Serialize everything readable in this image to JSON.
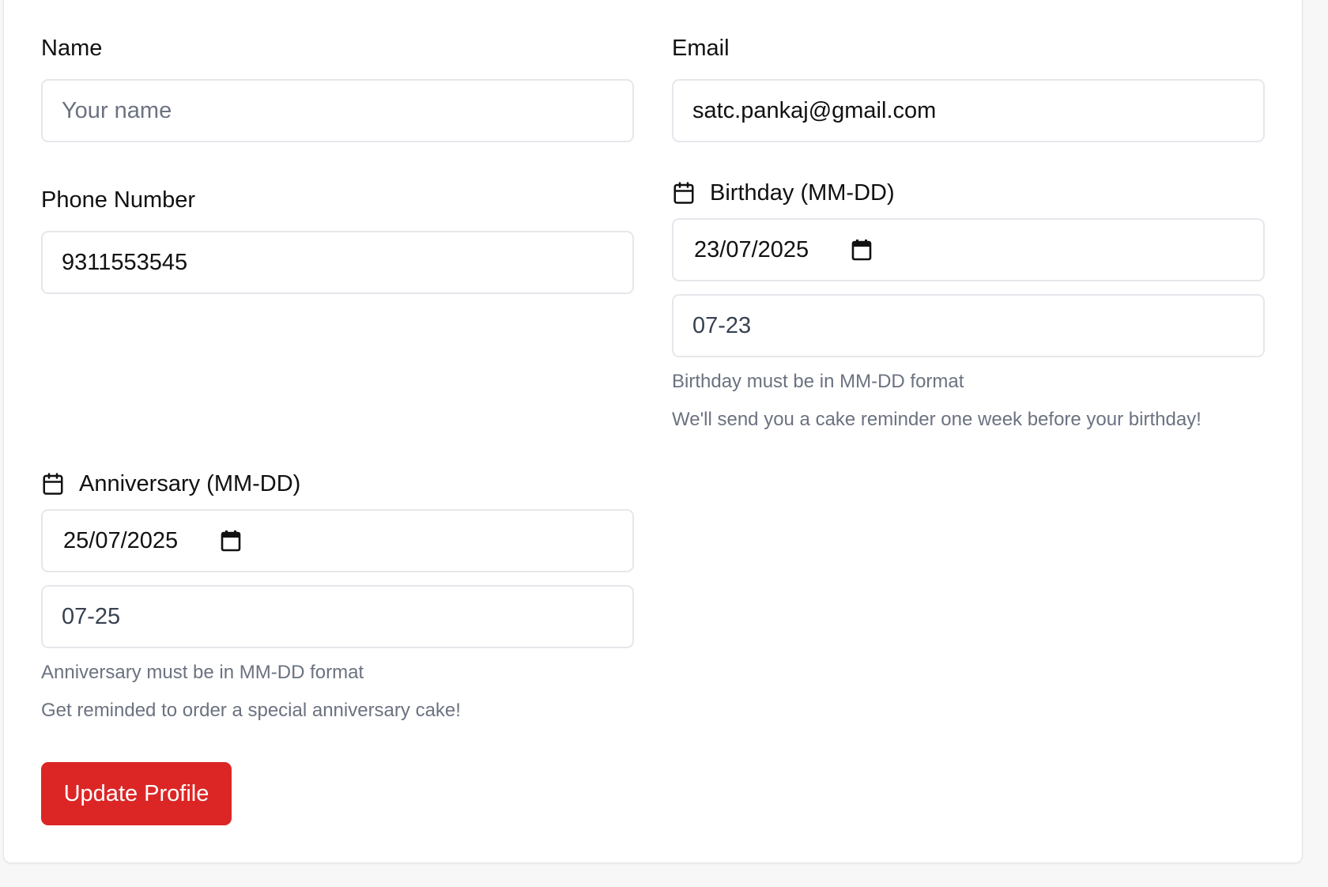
{
  "form": {
    "name": {
      "label": "Name",
      "placeholder": "Your name",
      "value": ""
    },
    "email": {
      "label": "Email",
      "value": "satc.pankaj@gmail.com"
    },
    "phone": {
      "label": "Phone Number",
      "value": "9311553545"
    },
    "birthday": {
      "label": "Birthday (MM-DD)",
      "icon": "calendar-icon",
      "date_value": "23/07/2025",
      "mmdd_value": "07-23",
      "help_format": "Birthday must be in MM-DD format",
      "help_reminder": "We'll send you a cake reminder one week before your birthday!"
    },
    "anniversary": {
      "label": "Anniversary (MM-DD)",
      "icon": "calendar-icon",
      "date_value": "25/07/2025",
      "mmdd_value": "07-25",
      "help_format": "Anniversary must be in MM-DD format",
      "help_reminder": "Get reminded to order a special anniversary cake!"
    },
    "submit_label": "Update Profile"
  },
  "colors": {
    "accent": "#dc2626",
    "muted_text": "#6b7280",
    "input_border": "#e5e7eb",
    "background": "#f7f7f8"
  }
}
